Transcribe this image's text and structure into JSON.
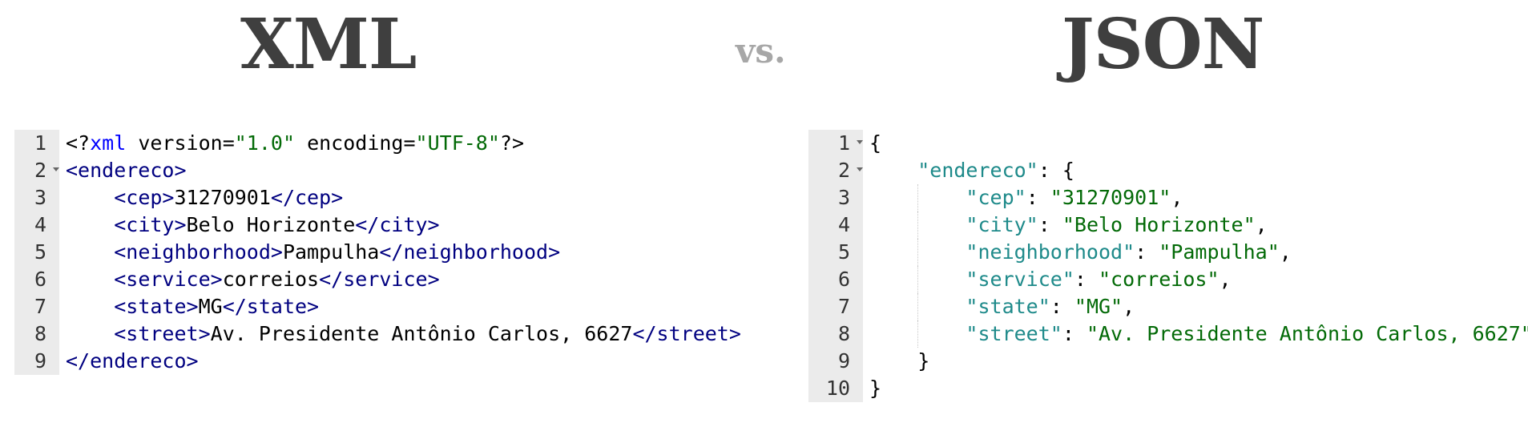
{
  "titles": {
    "left": "XML",
    "vs": "vs.",
    "right": "JSON"
  },
  "xml": {
    "line_numbers": [
      "1",
      "2",
      "3",
      "4",
      "5",
      "6",
      "7",
      "8",
      "9"
    ],
    "declaration": {
      "open": "<?",
      "name": "xml",
      "attr1": " version",
      "eq1": "=",
      "val1": "\"1.0\"",
      "attr2": " encoding",
      "eq2": "=",
      "val2": "\"UTF-8\"",
      "close": "?>"
    },
    "root_open": "<endereco>",
    "root_close": "</endereco>",
    "fields": [
      {
        "open": "<cep>",
        "value": "31270901",
        "close": "</cep>"
      },
      {
        "open": "<city>",
        "value": "Belo Horizonte",
        "close": "</city>"
      },
      {
        "open": "<neighborhood>",
        "value": "Pampulha",
        "close": "</neighborhood>"
      },
      {
        "open": "<service>",
        "value": "correios",
        "close": "</service>"
      },
      {
        "open": "<state>",
        "value": "MG",
        "close": "</state>"
      },
      {
        "open": "<street>",
        "value": "Av. Presidente Antônio Carlos, 6627",
        "close": "</street>"
      }
    ]
  },
  "json": {
    "line_numbers": [
      "1",
      "2",
      "3",
      "4",
      "5",
      "6",
      "7",
      "8",
      "9",
      "10"
    ],
    "open_brace": "{",
    "close_brace": "}",
    "object_key": "\"endereco\"",
    "object_sep": ": {",
    "object_close": "}",
    "fields": [
      {
        "key": "\"cep\"",
        "sep": ": ",
        "value": "\"31270901\"",
        "end": ","
      },
      {
        "key": "\"city\"",
        "sep": ": ",
        "value": "\"Belo Horizonte\"",
        "end": ","
      },
      {
        "key": "\"neighborhood\"",
        "sep": ": ",
        "value": "\"Pampulha\"",
        "end": ","
      },
      {
        "key": "\"service\"",
        "sep": ": ",
        "value": "\"correios\"",
        "end": ","
      },
      {
        "key": "\"state\"",
        "sep": ": ",
        "value": "\"MG\"",
        "end": ","
      },
      {
        "key": "\"street\"",
        "sep": ": ",
        "value": "\"Av. Presidente Antônio Carlos, 6627\"",
        "end": ""
      }
    ]
  },
  "colors": {
    "tag": "#000080",
    "attribute": "#0000ff",
    "string": "#036a07",
    "json_key": "#1e8a8a",
    "title": "#3f3f3f",
    "vs": "#a7a7a7",
    "gutter": "#ebebeb"
  }
}
